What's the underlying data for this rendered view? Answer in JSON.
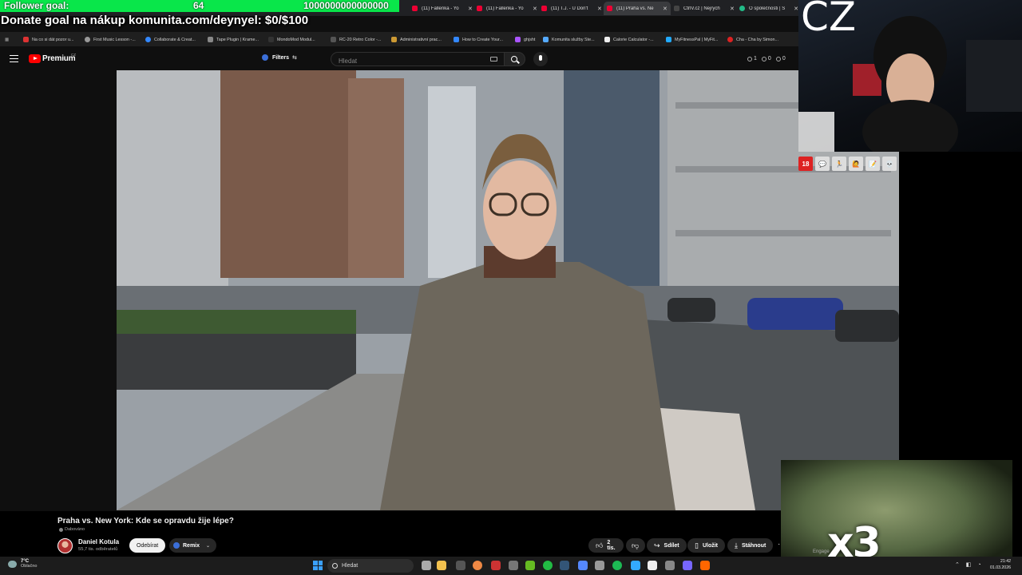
{
  "overlay": {
    "follower_goal_label": "Follower goal:",
    "follower_count": "64",
    "follower_target": "1000000000000000",
    "donate_goal": "Donate goal na nákup komunita.com/deynyel: $0/$100",
    "cz_text": "CZ",
    "x3_text": "x3",
    "engage_text": "Engage",
    "mod_icons": [
      "18",
      "💬",
      "🏃",
      "🙋",
      "📝",
      "💀"
    ]
  },
  "tabs": [
    {
      "label": "(11) Fallenka - Yo"
    },
    {
      "label": "(11) Fallenka - Yo"
    },
    {
      "label": "(11) T.J. - U Don't"
    },
    {
      "label": "(11) Praha vs. Ne"
    },
    {
      "label": "CtrlV.cz | Nejrych"
    },
    {
      "label": "O společnosti | S"
    }
  ],
  "bookmarks": [
    {
      "label": "Na co si dát pozor u...",
      "color": "#d33"
    },
    {
      "label": "First Music Lesson -...",
      "color": "#999"
    },
    {
      "label": "Collaborate & Creat...",
      "color": "#38f"
    },
    {
      "label": "Tape Plugin | Krame...",
      "color": "#888"
    },
    {
      "label": "MondoMod Modul...",
      "color": "#333"
    },
    {
      "label": "RC-20 Retro Color -...",
      "color": "#222"
    },
    {
      "label": "Administrativní prac...",
      "color": "#c93"
    },
    {
      "label": "How to Create Your...",
      "color": "#38f"
    },
    {
      "label": "ghjsht",
      "color": "#a5f"
    },
    {
      "label": "Komunita služby Ste...",
      "color": "#5af"
    },
    {
      "label": "Calorie Calculator -...",
      "color": "#eee"
    },
    {
      "label": "MyFitnessPal | MyFit...",
      "color": "#2af"
    },
    {
      "label": "Cha - Cha by Simon...",
      "color": "#d22"
    }
  ],
  "youtube": {
    "brand": "Premium",
    "country": "CZ",
    "filters_label": "Filters",
    "search_placeholder": "Hledat",
    "counters": [
      "1",
      "0",
      "0"
    ]
  },
  "video": {
    "title": "Praha vs. New York: Kde se opravdu žije lépe?",
    "dubbed": "Dabováno",
    "channel_name": "Daniel Kotula",
    "channel_subs": "55,7 tis. odběratelů",
    "subscribe_label": "Odebírat",
    "remix_label": "Remix",
    "likes_label": "2 tis.",
    "share_label": "Sdílet",
    "save_label": "Uložit",
    "download_label": "Stáhnout"
  },
  "taskbar": {
    "temperature": "7°C",
    "condition": "Oblačno",
    "search_label": "Hledat",
    "time": "21:42",
    "date": "01.03.2026"
  }
}
